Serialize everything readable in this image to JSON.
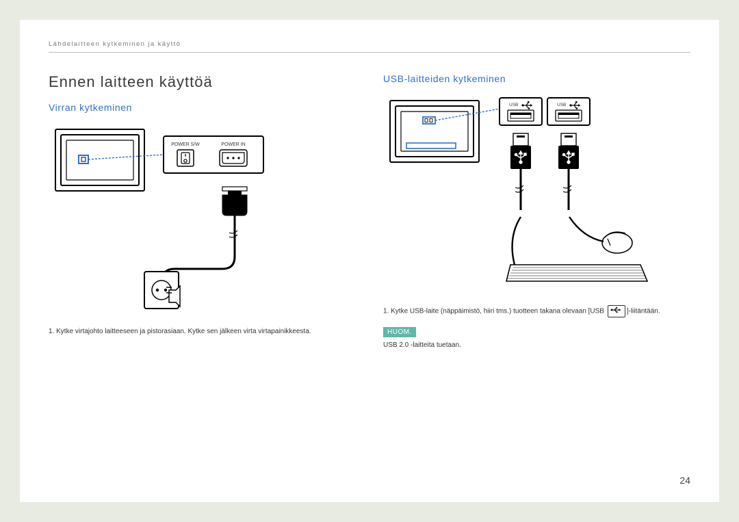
{
  "header": {
    "breadcrumb": "Lähdelaitteen kytkeminen ja käyttö"
  },
  "left": {
    "title": "Ennen laitteen käyttöä",
    "subtitle": "Virran kytkeminen",
    "power_panel": {
      "label_sw": "POWER S/W",
      "label_in": "POWER IN"
    },
    "step1_prefix": "1. ",
    "step1": "Kytke virtajohto laitteeseen ja pistorasiaan. Kytke sen jälkeen virta virtapainikkeesta."
  },
  "right": {
    "subtitle": "USB-laitteiden kytkeminen",
    "usb_label": "USB",
    "step1_prefix": "1. ",
    "step1_a": "Kytke USB-laite (näppäimistö, hiiri tms.) tuotteen takana olevaan [USB ",
    "step1_b": "]-liitäntään.",
    "note_badge": "HUOM.",
    "note_text": "USB 2.0 -laitteita tuetaan."
  },
  "page_number": "24"
}
